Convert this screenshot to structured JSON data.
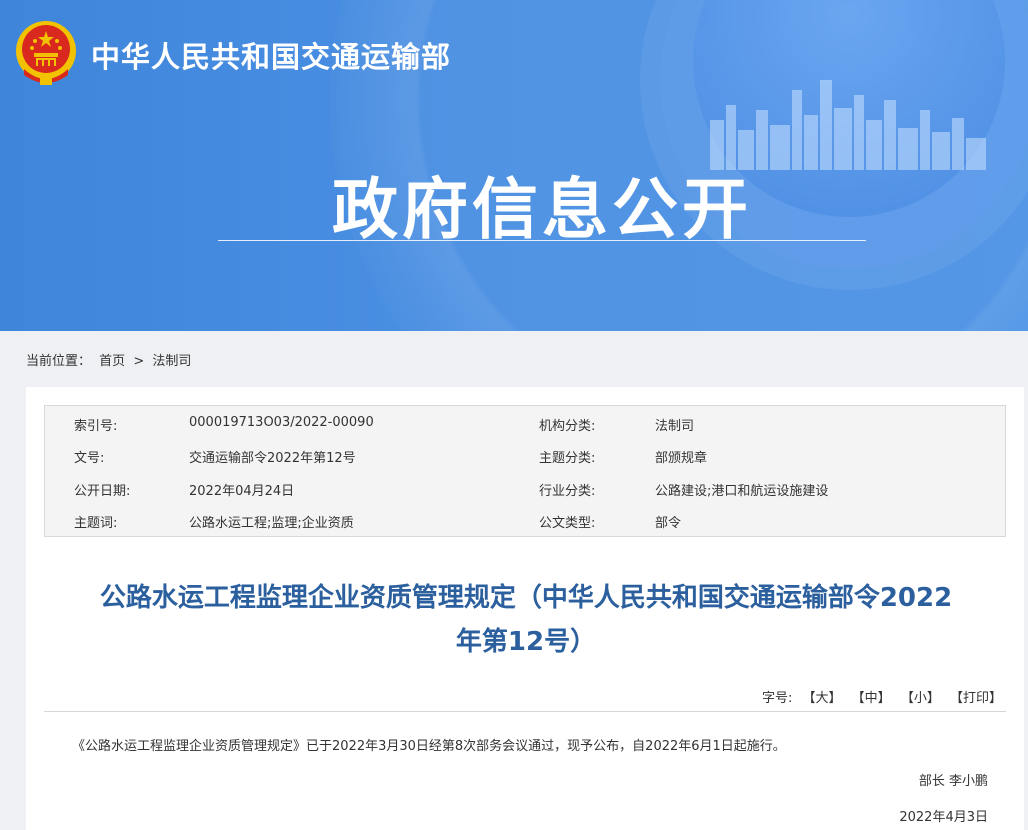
{
  "header": {
    "ministry_name": "中华人民共和国交通运输部",
    "banner_title": "政府信息公开",
    "colors": {
      "banner_blue": "#4a8fe2",
      "title_blue": "#2b5f9e",
      "emblem_red": "#d9281e",
      "emblem_gold": "#f2c200"
    }
  },
  "breadcrumb": {
    "label": "当前位置：",
    "home": "首页",
    "separator": ">",
    "current": "法制司"
  },
  "meta": {
    "rows": [
      {
        "k1": "索引号:",
        "v1": "000019713O03/2022-00090",
        "k2": "机构分类:",
        "v2": "法制司"
      },
      {
        "k1": "文号:",
        "v1": "交通运输部令2022年第12号",
        "k2": "主题分类:",
        "v2": "部颁规章"
      },
      {
        "k1": "公开日期:",
        "v1": "2022年04月24日",
        "k2": "行业分类:",
        "v2": "公路建设;港口和航运设施建设"
      },
      {
        "k1": "主题词:",
        "v1": "公路水运工程;监理;企业资质",
        "k2": "公文类型:",
        "v2": "部令"
      }
    ]
  },
  "article": {
    "title_line1": "公路水运工程监理企业资质管理规定（中华人民共和国交通运输部令2022",
    "title_line2": "年第12号）",
    "font_size_label": "字号:",
    "font_size_large": "【大】",
    "font_size_medium": "【中】",
    "font_size_small": "【小】",
    "print": "【打印】",
    "body": "《公路水运工程监理企业资质管理规定》已于2022年3月30日经第8次部务会议通过，现予公布，自2022年6月1日起施行。",
    "signer": "部长 李小鹏",
    "date": "2022年4月3日"
  }
}
